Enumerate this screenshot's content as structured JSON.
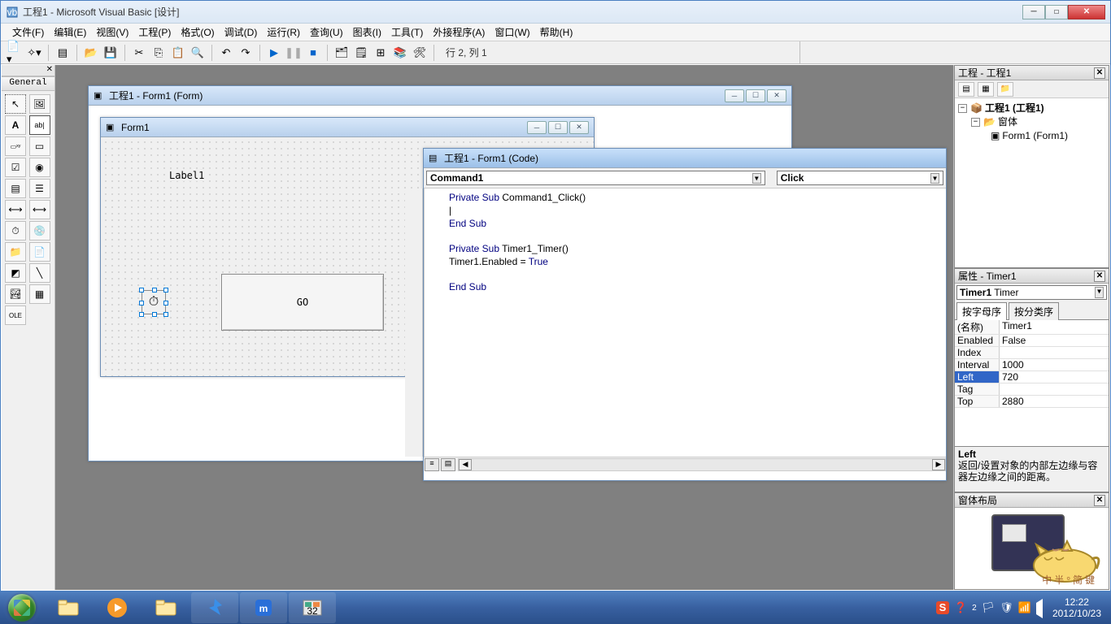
{
  "title": "工程1 - Microsoft Visual Basic [设计]",
  "menu": [
    "文件(F)",
    "编辑(E)",
    "视图(V)",
    "工程(P)",
    "格式(O)",
    "调试(D)",
    "运行(R)",
    "查询(U)",
    "图表(I)",
    "工具(T)",
    "外接程序(A)",
    "窗口(W)",
    "帮助(H)"
  ],
  "toolbar_status": "行 2, 列 1",
  "toolbox": {
    "title": "General"
  },
  "designer_window": {
    "title": "工程1 - Form1 (Form)",
    "form_title": "Form1",
    "label1": "Label1",
    "go_btn": "GO"
  },
  "code_window": {
    "title": "工程1 - Form1 (Code)",
    "object_sel": "Command1",
    "proc_sel": "Click",
    "code": [
      {
        "t": "kw",
        "s": "Private Sub "
      },
      {
        "t": "plain",
        "s": "Command1_Click()"
      },
      {
        "t": "br"
      },
      {
        "t": "plain",
        "s": "|"
      },
      {
        "t": "br"
      },
      {
        "t": "kw",
        "s": "End Sub"
      },
      {
        "t": "br"
      },
      {
        "t": "br"
      },
      {
        "t": "kw",
        "s": "Private Sub "
      },
      {
        "t": "plain",
        "s": "Timer1_Timer()"
      },
      {
        "t": "br"
      },
      {
        "t": "plain",
        "s": "Timer1.Enabled = "
      },
      {
        "t": "kw",
        "s": "True"
      },
      {
        "t": "br"
      },
      {
        "t": "br"
      },
      {
        "t": "kw",
        "s": "End Sub"
      }
    ]
  },
  "project_panel": {
    "title": "工程 - 工程1",
    "root": "工程1 (工程1)",
    "folder": "窗体",
    "form": "Form1 (Form1)"
  },
  "props_panel": {
    "title": "属性 - Timer1",
    "object": "Timer1 Timer",
    "tabs": [
      "按字母序",
      "按分类序"
    ],
    "rows": [
      {
        "name": "(名称)",
        "value": "Timer1"
      },
      {
        "name": "Enabled",
        "value": "False"
      },
      {
        "name": "Index",
        "value": ""
      },
      {
        "name": "Interval",
        "value": "1000"
      },
      {
        "name": "Left",
        "value": "720",
        "selected": true
      },
      {
        "name": "Tag",
        "value": ""
      },
      {
        "name": "Top",
        "value": "2880"
      }
    ],
    "desc_title": "Left",
    "desc_body": "返回/设置对象的内部左边缘与容器左边缘之间的距离。"
  },
  "layout_panel": {
    "title": "窗体布局"
  },
  "ime": "中 半 ° 简 键",
  "taskbar": {
    "time": "12:22",
    "date": "2012/10/23"
  }
}
